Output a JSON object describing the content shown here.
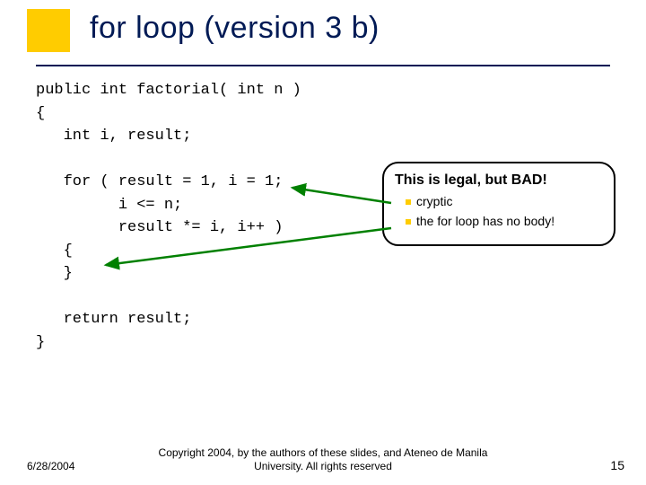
{
  "title": "for loop (version 3 b)",
  "code": "public int factorial( int n )\n{\n   int i, result;\n\n   for ( result = 1, i = 1;\n         i <= n;\n         result *= i, i++ )\n   {\n   }\n\n   return result;\n}",
  "callout": {
    "heading": "This is legal, but BAD!",
    "items": [
      "cryptic",
      "the for loop has no body!"
    ]
  },
  "footer": {
    "date": "6/28/2004",
    "copyright": "Copyright 2004, by the authors of these slides, and Ateneo de Manila University. All rights reserved",
    "slide_number": "15"
  },
  "accent_color": "#ffcc00",
  "arrow_color": "#008000"
}
